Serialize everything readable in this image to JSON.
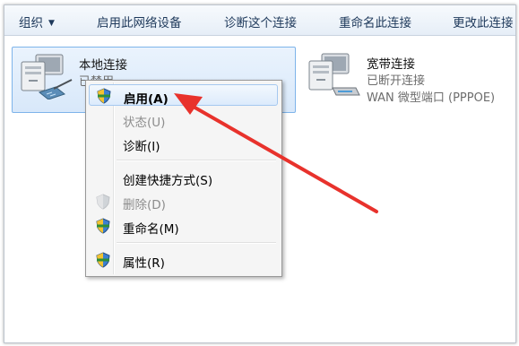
{
  "toolbar": {
    "organize": "组织",
    "enable": "启用此网络设备",
    "diagnose": "诊断这个连接",
    "rename": "重命名此连接",
    "change": "更改此连接"
  },
  "connections": [
    {
      "name": "本地连接",
      "status": "已禁用",
      "device": ""
    },
    {
      "name": "宽带连接",
      "status": "已断开连接",
      "device": "WAN 微型端口 (PPPOE)"
    }
  ],
  "context_menu": {
    "items": [
      {
        "label": "启用(A)",
        "disabled": false,
        "default": true,
        "icon": "shield-icon"
      },
      {
        "label": "状态(U)",
        "disabled": true
      },
      {
        "label": "诊断(I)",
        "disabled": false
      },
      {
        "label": "创建快捷方式(S)",
        "disabled": false
      },
      {
        "label": "删除(D)",
        "disabled": true,
        "icon": "shield-icon"
      },
      {
        "label": "重命名(M)",
        "disabled": false,
        "icon": "shield-icon"
      },
      {
        "label": "属性(R)",
        "disabled": false,
        "icon": "shield-icon"
      }
    ]
  },
  "colors": {
    "toolbar_text": "#1e395b",
    "selection_bg": "#d8e8fa",
    "selection_border": "#7eb4ea",
    "annotation_arrow": "#e8322c"
  }
}
